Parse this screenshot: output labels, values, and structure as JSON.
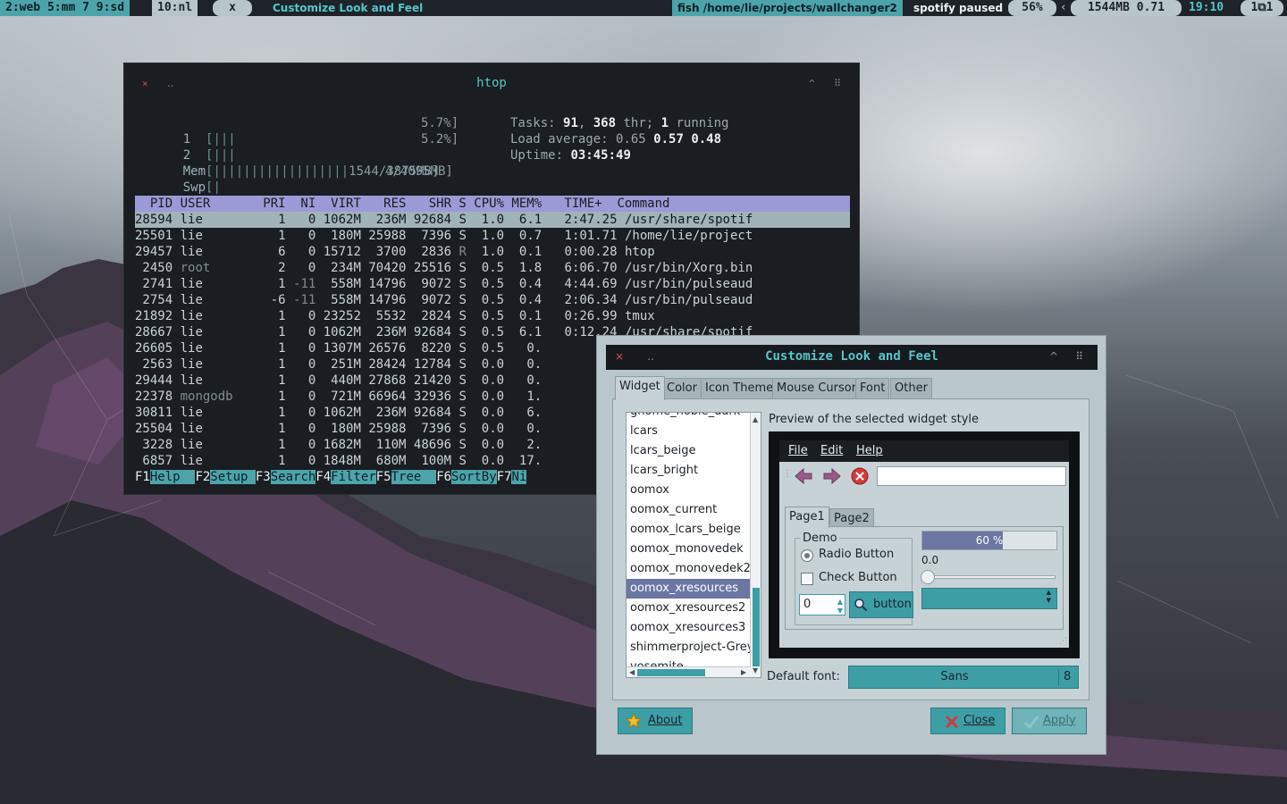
{
  "topbar": {
    "workspaces": "2:web 5:mm 7 9:sd",
    "active_ws": "10:nl",
    "close_label": "x",
    "window_title": "Customize Look and Feel",
    "shell": "fish /home/lie/projects/wallchanger2",
    "music": "spotify paused",
    "volume": "56%",
    "mem_load": "1544MB 0.71",
    "clock": "19:10",
    "tray": "1⧉1"
  },
  "htop": {
    "title": "htop",
    "cpu1": {
      "label": "1",
      "bar": "[|||",
      "value": "5.7%]"
    },
    "cpu2": {
      "label": "2",
      "bar": "[|||",
      "value": "5.2%]"
    },
    "mem": {
      "label": "Mem",
      "bar": "[||||||||||||||||||",
      "value": "1544/3875MB]"
    },
    "swp": {
      "label": "Swp",
      "bar": "[|",
      "value": "4/4095MB]"
    },
    "tasks": {
      "label": "Tasks: ",
      "count": "91",
      "sep": ", ",
      "thr": "368",
      "thr_label": " thr; ",
      "running": "1",
      "running_label": " running"
    },
    "load": {
      "label": "Load average: ",
      "l1": "0.65",
      "l5": "0.57",
      "l15": "0.48"
    },
    "uptime": {
      "label": "Uptime: ",
      "value": "03:45:49"
    },
    "header": "  PID USER       PRI  NI  VIRT   RES   SHR S CPU% MEM%   TIME+  Command",
    "processes": [
      {
        "pid": "28594",
        "user": "lie",
        "pri": "1",
        "ni": "0",
        "virt": "1062M",
        "res": "236M",
        "shr": "92684",
        "s": "S",
        "cpu": "1.0",
        "mem": "6.1",
        "time": "2:47.25",
        "cmd": "/usr/share/spotif"
      },
      {
        "pid": "25501",
        "user": "lie",
        "pri": "1",
        "ni": "0",
        "virt": "180M",
        "res": "25988",
        "shr": "7396",
        "s": "S",
        "cpu": "1.0",
        "mem": "0.7",
        "time": "1:01.71",
        "cmd": "/home/lie/project"
      },
      {
        "pid": "29457",
        "user": "lie",
        "pri": "6",
        "ni": "0",
        "virt": "15712",
        "res": "3700",
        "shr": "2836",
        "s": "R",
        "cpu": "1.0",
        "mem": "0.1",
        "time": "0:00.28",
        "cmd": "htop"
      },
      {
        "pid": "2450",
        "user": "root",
        "pri": "2",
        "ni": "0",
        "virt": "234M",
        "res": "70420",
        "shr": "25516",
        "s": "S",
        "cpu": "0.5",
        "mem": "1.8",
        "time": "6:06.70",
        "cmd": "/usr/bin/Xorg.bin"
      },
      {
        "pid": "2741",
        "user": "lie",
        "pri": "1",
        "ni": "-11",
        "virt": "558M",
        "res": "14796",
        "shr": "9072",
        "s": "S",
        "cpu": "0.5",
        "mem": "0.4",
        "time": "4:44.69",
        "cmd": "/usr/bin/pulseaud"
      },
      {
        "pid": "2754",
        "user": "lie",
        "pri": "-6",
        "ni": "-11",
        "virt": "558M",
        "res": "14796",
        "shr": "9072",
        "s": "S",
        "cpu": "0.5",
        "mem": "0.4",
        "time": "2:06.34",
        "cmd": "/usr/bin/pulseaud"
      },
      {
        "pid": "21892",
        "user": "lie",
        "pri": "1",
        "ni": "0",
        "virt": "23252",
        "res": "5532",
        "shr": "2824",
        "s": "S",
        "cpu": "0.5",
        "mem": "0.1",
        "time": "0:26.99",
        "cmd": "tmux"
      },
      {
        "pid": "28667",
        "user": "lie",
        "pri": "1",
        "ni": "0",
        "virt": "1062M",
        "res": "236M",
        "shr": "92684",
        "s": "S",
        "cpu": "0.5",
        "mem": "6.1",
        "time": "0:12.24",
        "cmd": "/usr/share/spotif"
      },
      {
        "pid": "26605",
        "user": "lie",
        "pri": "1",
        "ni": "0",
        "virt": "1307M",
        "res": "26576",
        "shr": "8220",
        "s": "S",
        "cpu": "0.5",
        "mem": "0.",
        "time": "",
        "cmd": ""
      },
      {
        "pid": "2563",
        "user": "lie",
        "pri": "1",
        "ni": "0",
        "virt": "251M",
        "res": "28424",
        "shr": "12784",
        "s": "S",
        "cpu": "0.0",
        "mem": "0.",
        "time": "",
        "cmd": ""
      },
      {
        "pid": "29444",
        "user": "lie",
        "pri": "1",
        "ni": "0",
        "virt": "440M",
        "res": "27868",
        "shr": "21420",
        "s": "S",
        "cpu": "0.0",
        "mem": "0.",
        "time": "",
        "cmd": ""
      },
      {
        "pid": "22378",
        "user": "mongodb",
        "pri": "1",
        "ni": "0",
        "virt": "721M",
        "res": "66964",
        "shr": "32936",
        "s": "S",
        "cpu": "0.0",
        "mem": "1.",
        "time": "",
        "cmd": ""
      },
      {
        "pid": "30811",
        "user": "lie",
        "pri": "1",
        "ni": "0",
        "virt": "1062M",
        "res": "236M",
        "shr": "92684",
        "s": "S",
        "cpu": "0.0",
        "mem": "6.",
        "time": "",
        "cmd": ""
      },
      {
        "pid": "25504",
        "user": "lie",
        "pri": "1",
        "ni": "0",
        "virt": "180M",
        "res": "25988",
        "shr": "7396",
        "s": "S",
        "cpu": "0.0",
        "mem": "0.",
        "time": "",
        "cmd": ""
      },
      {
        "pid": "3228",
        "user": "lie",
        "pri": "1",
        "ni": "0",
        "virt": "1682M",
        "res": "110M",
        "shr": "48696",
        "s": "S",
        "cpu": "0.0",
        "mem": "2.",
        "time": "",
        "cmd": ""
      },
      {
        "pid": "6857",
        "user": "lie",
        "pri": "1",
        "ni": "0",
        "virt": "1848M",
        "res": "680M",
        "shr": "100M",
        "s": "S",
        "cpu": "0.0",
        "mem": "17.",
        "time": "",
        "cmd": ""
      }
    ],
    "fkeys": [
      {
        "key": "F1",
        "label": "Help  "
      },
      {
        "key": "F2",
        "label": "Setup "
      },
      {
        "key": "F3",
        "label": "Search"
      },
      {
        "key": "F4",
        "label": "Filter"
      },
      {
        "key": "F5",
        "label": "Tree  "
      },
      {
        "key": "F6",
        "label": "SortBy"
      },
      {
        "key": "F7",
        "label": "Ni"
      }
    ]
  },
  "dialog": {
    "title": "Customize Look and Feel",
    "tabs": [
      "Widget",
      "Color",
      "Icon Theme",
      "Mouse Cursor",
      "Font",
      "Other"
    ],
    "themes": [
      "gnome_noble_dark",
      "lcars",
      "lcars_beige",
      "lcars_bright",
      "oomox",
      "oomox_current",
      "oomox_lcars_beige",
      "oomox_monovedek",
      "oomox_monovedek2",
      "oomox_xresources",
      "oomox_xresources2",
      "oomox_xresources3",
      "shimmerproject-Greybird",
      "yosemite"
    ],
    "selected_theme": "oomox_xresources",
    "preview_label": "Preview of the selected widget style",
    "preview": {
      "menu": [
        "File",
        "Edit",
        "Help"
      ],
      "tabs": [
        "Page1",
        "Page2"
      ],
      "demo_label": "Demo",
      "radio_label": "Radio Button",
      "check_label": "Check Button",
      "spin_value": "0",
      "button_label": "button",
      "progress_text": "60 %",
      "progress_value": 0.6,
      "slider_value": "0.0"
    },
    "default_font_label": "Default font:",
    "font_name": "Sans",
    "font_size": "8",
    "about_label": "About",
    "close_label": "Close",
    "apply_label": "Apply"
  }
}
